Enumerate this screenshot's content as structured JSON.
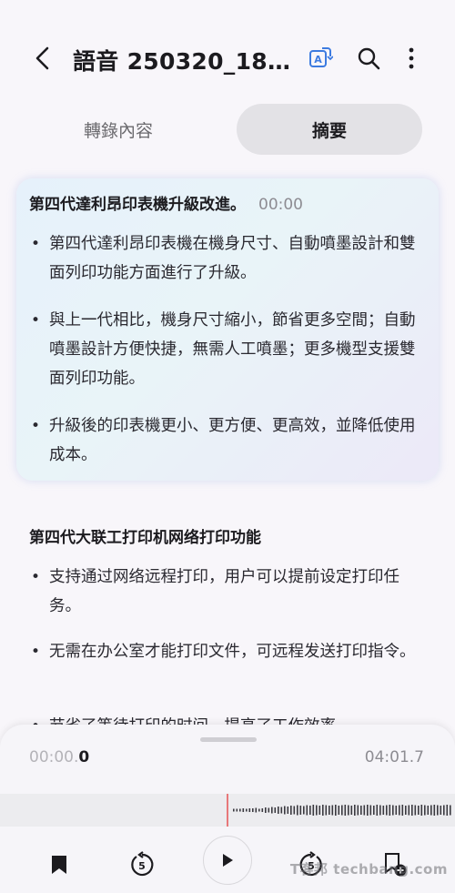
{
  "header": {
    "title": "語音 250320_182…",
    "back_icon": "chevron-left-icon",
    "translate_icon": "translate-icon",
    "search_icon": "search-icon",
    "more_icon": "more-vertical-icon",
    "accent_color": "#3d7be0"
  },
  "tabs": [
    {
      "label": "轉錄內容",
      "selected": false
    },
    {
      "label": "摘要",
      "selected": true
    }
  ],
  "summary": {
    "sections": [
      {
        "title": "第四代達利昂印表機升級改進。",
        "timestamp": "00:00",
        "bullets": [
          "第四代達利昂印表機在機身尺寸、自動噴墨設計和雙面列印功能方面進行了升級。",
          "與上一代相比，機身尺寸縮小，節省更多空間；自動噴墨設計方便快捷，無需人工噴墨；更多機型支援雙面列印功能。",
          "升級後的印表機更小、更方便、更高效，並降低使用成本。"
        ]
      },
      {
        "title": "第四代大联工打印机网络打印功能",
        "timestamp": "",
        "bullets": [
          "支持通过网络远程打印，用户可以提前设定打印任务。",
          "无需在办公室才能打印文件，可远程发送打印指令。",
          "节省了等待打印的时间，提高了工作效率。"
        ]
      }
    ]
  },
  "player": {
    "current_time_dim": "00:00.",
    "current_time_bold": "0",
    "total_time": "04:01.7",
    "controls": {
      "bookmark_icon": "bookmark-icon",
      "rewind_icon": "rewind-5-icon",
      "rewind_label": "5",
      "play_icon": "play-icon",
      "forward_icon": "forward-5-icon",
      "forward_label": "5",
      "add_bookmark_icon": "bookmark-add-icon"
    },
    "playhead_color": "#e8787a"
  },
  "watermark": "T客邦 techbang.com"
}
